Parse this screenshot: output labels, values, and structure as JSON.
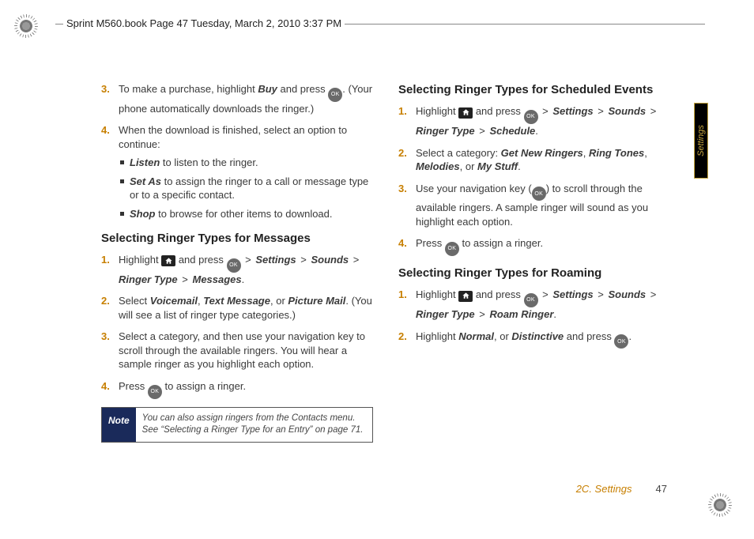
{
  "header": "Sprint M560.book  Page 47  Tuesday, March 2, 2010  3:37 PM",
  "tab": "Settings",
  "footer": {
    "section": "2C. Settings",
    "page": "47"
  },
  "icons": {
    "ok": "OK"
  },
  "left": {
    "pre": {
      "s3": {
        "num": "3.",
        "t1": "To make a purchase, highlight ",
        "buy": "Buy",
        "t2": " and press ",
        "t3": ". (Your phone automatically downloads the ringer.)"
      },
      "s4": {
        "num": "4.",
        "t": "When the download is finished, select an option to continue:",
        "b1": {
          "l": "Listen",
          "t": " to listen to the ringer."
        },
        "b2": {
          "l": "Set As",
          "t": " to assign the ringer to a call or message type or to a specific contact."
        },
        "b3": {
          "l": "Shop",
          "t": " to browse for other items to download."
        }
      }
    },
    "h1": "Selecting Ringer Types for Messages",
    "msg": {
      "s1": {
        "num": "1.",
        "t1": "Highlight ",
        "t2": " and press ",
        "p1": "Settings",
        "p2": "Sounds",
        "p3": "Ringer Type",
        "p4": "Messages",
        "dot": "."
      },
      "s2": {
        "num": "2.",
        "t1": "Select ",
        "o1": "Voicemail",
        "o2": "Text Message",
        "o3": "Picture Mail",
        "t2": ". (You will see a list of ringer type categories.)"
      },
      "s3": {
        "num": "3.",
        "t": "Select a category, and then use your navigation key to scroll through the available ringers. You will hear a sample ringer as you highlight each option."
      },
      "s4": {
        "num": "4.",
        "t1": "Press ",
        "t2": " to assign a ringer."
      }
    },
    "note": {
      "label": "Note",
      "text": "You can also assign ringers from the Contacts menu. See “Selecting a Ringer Type for an Entry” on page 71."
    }
  },
  "right": {
    "h1": "Selecting Ringer Types for Scheduled Events",
    "sch": {
      "s1": {
        "num": "1.",
        "t1": "Highlight ",
        "t2": " and press ",
        "p1": "Settings",
        "p2": "Sounds",
        "p3": "Ringer Type",
        "p4": "Schedule",
        "dot": "."
      },
      "s2": {
        "num": "2.",
        "t1": "Select a category: ",
        "o1": "Get New Ringers",
        "o2": "Ring Tones",
        "o3": "Melodies",
        "o4": "My Stuff",
        "t2": "."
      },
      "s3": {
        "num": "3.",
        "t1": "Use your navigation key (",
        "t2": ") to scroll through the available ringers. A sample ringer will sound as you highlight each option."
      },
      "s4": {
        "num": "4.",
        "t1": "Press ",
        "t2": " to assign a ringer."
      }
    },
    "h2": "Selecting Ringer Types for Roaming",
    "roam": {
      "s1": {
        "num": "1.",
        "t1": "Highlight ",
        "t2": " and press ",
        "p1": "Settings",
        "p2": "Sounds",
        "p3": "Ringer Type",
        "p4": "Roam Ringer",
        "dot": "."
      },
      "s2": {
        "num": "2.",
        "t1": "Highlight ",
        "o1": "Normal",
        "o2": "Distinctive",
        "t2": " and press ",
        "dot": "."
      }
    }
  },
  "sep": {
    "comma": ", ",
    "or": ", or ",
    "gt": " > "
  }
}
